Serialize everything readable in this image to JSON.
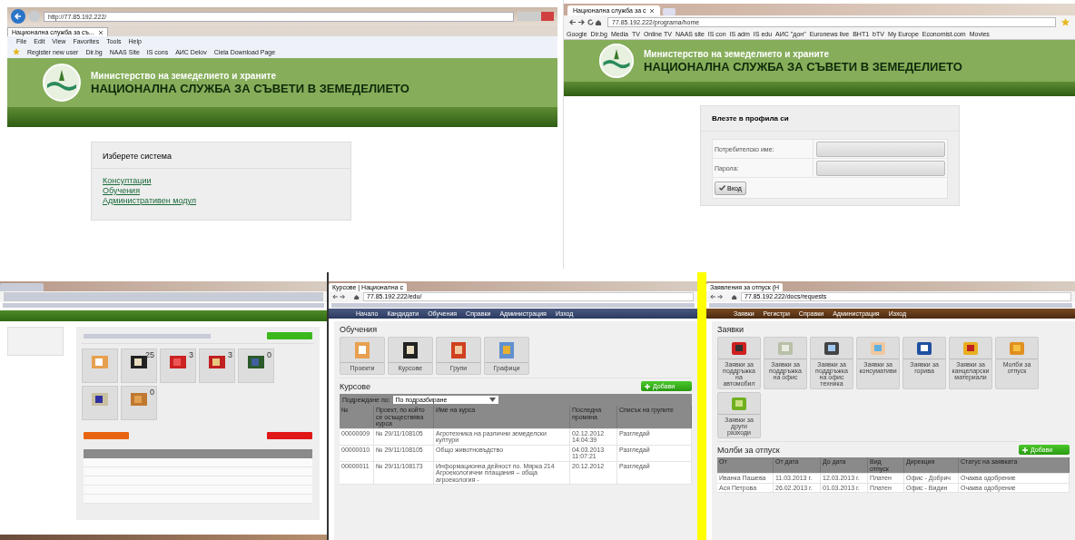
{
  "window_1": {
    "tab": "Национална служба за съ...",
    "address": "http://77.85.192.222/",
    "menu": [
      "File",
      "Edit",
      "View",
      "Favorites",
      "Tools",
      "Help"
    ],
    "favorites": [
      "Register new user",
      "Dir.bg",
      "NAAS Site",
      "IS cons",
      "АИС Delov",
      "Ciela Download Page"
    ],
    "header": {
      "subtitle": "Министерство на земеделието и храните",
      "title": "НАЦИОНАЛНА СЛУЖБА ЗА СЪВЕТИ В ЗЕМЕДЕЛИЕТО"
    },
    "panel": {
      "title": "Изберете система",
      "links": [
        "Консултации",
        "Обучения",
        "Административен модул"
      ]
    }
  },
  "window_2": {
    "tab": "Национална служба за с",
    "address": "77.85.192.222/programa/home",
    "bookmarks": [
      "Google",
      "Dir.bg",
      "Media",
      "TV",
      "Online TV",
      "NAAS site",
      "IS con",
      "IS adm",
      "IS edu",
      "АИС \"дон\"",
      "Euronews live",
      "BHT1",
      "bTV",
      "My Europe",
      "Economist.com",
      "Movies"
    ],
    "header": {
      "subtitle": "Министерство на земеделието и храните",
      "title": "НАЦИОНАЛНА СЛУЖБА ЗА СЪВЕТИ В ЗЕМЕДЕЛИЕТО"
    },
    "login": {
      "title": "Влезте в профила си",
      "fields": [
        {
          "label": "Потребителско име:"
        },
        {
          "label": "Парола:"
        }
      ],
      "button": "Вход"
    }
  },
  "window_3": {
    "tiles": [
      {
        "kind": "plain"
      },
      {
        "kind": "counter",
        "count": "25"
      },
      {
        "kind": "counter",
        "count": "3"
      },
      {
        "kind": "counter",
        "count": "3"
      },
      {
        "kind": "counter",
        "count": "0"
      },
      {
        "kind": "plain"
      },
      {
        "kind": "counter",
        "count": "0"
      }
    ]
  },
  "window_4": {
    "tab": "Курсове | Национална с",
    "address": "77.85.192.222/edu/",
    "nav": [
      "Начало",
      "Кандидати",
      "Обучения",
      "Справки",
      "Администрация",
      "Изход"
    ],
    "heading": "Обучения",
    "tiles": [
      "Проекти",
      "Курсове",
      "Групи",
      "Графици"
    ],
    "section": "Курсове",
    "add_button": "Добави",
    "sort": {
      "label": "Подреждане по:",
      "value": "По подразбиране"
    },
    "table": {
      "columns": [
        "№",
        "Проект, по който се осъществява курса",
        "Име на курса",
        "Последна промяна",
        "Списък на групите"
      ],
      "rows": [
        [
          "00000009",
          "№ 29/11/108105",
          "Агротехника на различни земеделски култури",
          "02.12.2012 14:04:39",
          "Разгледай"
        ],
        [
          "00000010",
          "№ 29/11/108105",
          "Общо животновъдство",
          "04.03.2013 11:07:21",
          "Разгледай"
        ],
        [
          "00000011",
          "№ 29/11/108173",
          "Информационна дейност по. Мярка 214 Агроекологични плащания – обща агроекология -",
          "20.12.2012",
          "Разгледай"
        ]
      ]
    }
  },
  "window_5": {
    "tab": "Заявления за отпуск (Н",
    "address": "77.85.192.222/docs/requests",
    "nav": [
      "Заявки",
      "Регистри",
      "Справки",
      "Администрация",
      "Изход"
    ],
    "heading": "Заявки",
    "tiles": [
      "Заявки за поддръжка на автомобил",
      "Заявки за поддръжка на офис",
      "Заявки за поддръжка на офис техника",
      "Заявки за консумативи",
      "Заявки за горива",
      "Заявки за канцеларски материали",
      "Молби за отпуск",
      "Заявки за други разходи"
    ],
    "section": "Молби за отпуск",
    "add_button": "Добави",
    "table": {
      "columns": [
        "От",
        "От дата",
        "До дата",
        "Вид отпуск",
        "Дирекция",
        "Статус на заявката"
      ],
      "rows": [
        [
          "Иванка Пашева",
          "11.03.2013 г.",
          "12.03.2013 г.",
          "Платен",
          "Офис - Добрич",
          "Очаква одобрение"
        ],
        [
          "Ася Петрова",
          "26.02.2013 г.",
          "01.03.2013 г.",
          "Платен",
          "Офис - Видин",
          "Очаква одобрение"
        ]
      ]
    }
  }
}
